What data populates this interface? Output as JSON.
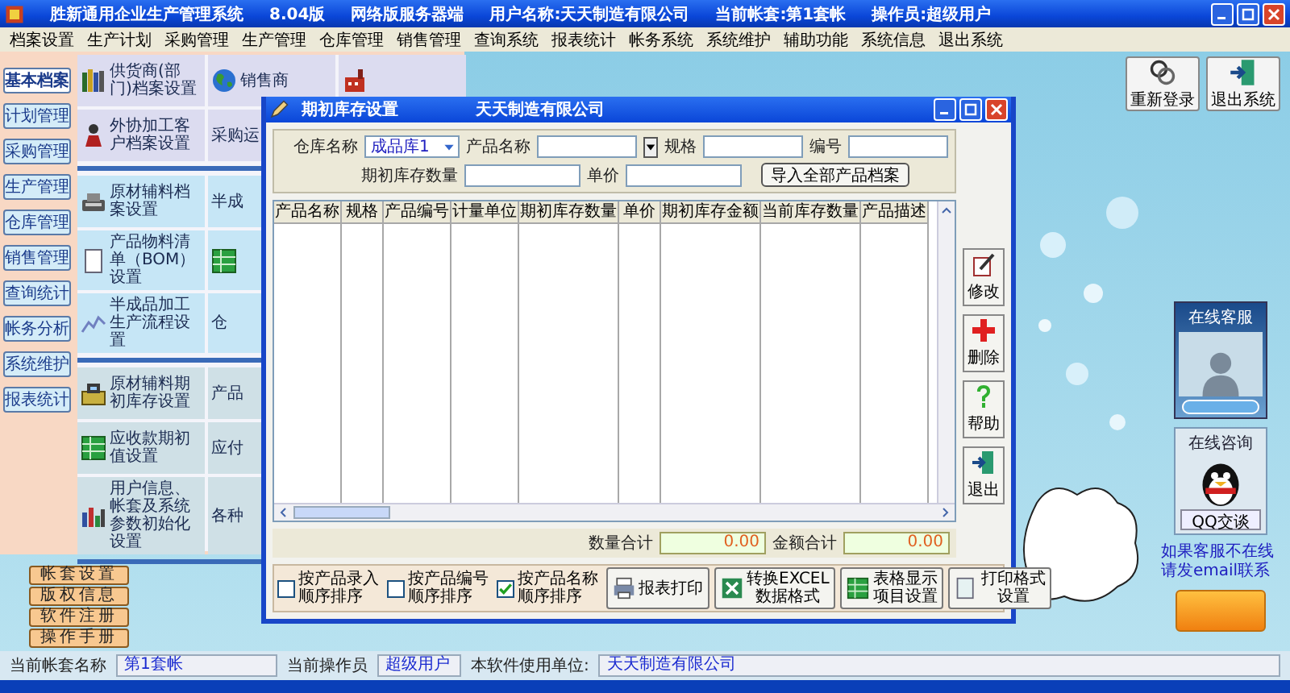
{
  "window": {
    "title": "胜新通用企业生产管理系统",
    "version": "8.04版",
    "edition": "网络版服务器端",
    "user_name": "用户名称:天天制造有限公司",
    "account_set": "当前帐套:第1套帐",
    "operator": "操作员:超级用户"
  },
  "menu": [
    "档案设置",
    "生产计划",
    "采购管理",
    "生产管理",
    "仓库管理",
    "销售管理",
    "查询系统",
    "报表统计",
    "帐务系统",
    "系统维护",
    "辅助功能",
    "系统信息",
    "退出系统"
  ],
  "side_tabs": [
    {
      "label": "基本档案",
      "selected": true
    },
    {
      "label": "计划管理",
      "selected": false
    },
    {
      "label": "采购管理",
      "selected": false
    },
    {
      "label": "生产管理",
      "selected": false
    },
    {
      "label": "仓库管理",
      "selected": false
    },
    {
      "label": "销售管理",
      "selected": false
    },
    {
      "label": "查询统计",
      "selected": false
    },
    {
      "label": "帐务分析",
      "selected": false
    },
    {
      "label": "系统维护",
      "selected": false
    },
    {
      "label": "报表统计",
      "selected": false
    }
  ],
  "tile_groups": [
    {
      "rows": [
        [
          {
            "label": "供货商(部门)档案设置"
          },
          {
            "label": "销售商"
          }
        ],
        [
          {
            "label": "外协加工客户档案设置"
          },
          {
            "label": "采购运"
          }
        ]
      ]
    },
    {
      "rows": [
        [
          {
            "label": "原材辅料档案设置"
          },
          {
            "label": "半成"
          }
        ],
        [
          {
            "label": "产品物料清单（BOM）设置"
          },
          {}
        ],
        [
          {
            "label": "半成品加工生产流程设置"
          },
          {
            "label": "仓"
          }
        ]
      ]
    },
    {
      "rows": [
        [
          {
            "label": "原材辅料期初库存设置"
          },
          {
            "label": "产品"
          }
        ],
        [
          {
            "label": "应收款期初值设置"
          },
          {
            "label": "应付"
          }
        ],
        [
          {
            "label": "用户信息、帐套及系统参数初始化设置"
          },
          {
            "label": "各种"
          }
        ]
      ]
    }
  ],
  "shortcut_buttons": [
    "帐套设置",
    "版权信息",
    "软件注册",
    "操作手册"
  ],
  "top_buttons": [
    "重新登录",
    "退出系统"
  ],
  "support": {
    "service_title": "在线客服",
    "consult_title": "在线咨询",
    "qq_button": "QQ交谈",
    "email_note": "如果客服不在线请发email联系"
  },
  "status_bar": [
    {
      "label": "当前帐套名称",
      "value": "第1套帐"
    },
    {
      "label": "当前操作员",
      "value": "超级用户"
    },
    {
      "label": "本软件使用单位:",
      "value": "天天制造有限公司"
    }
  ],
  "dialog": {
    "title": "期初库存设置",
    "company": "天天制造有限公司",
    "form": {
      "warehouse_label": "仓库名称",
      "warehouse_value": "成品库1",
      "product_label": "产品名称",
      "spec_label": "规格",
      "code_label": "编号",
      "qty_label": "期初库存数量",
      "price_label": "单价",
      "import_button": "导入全部产品档案"
    },
    "columns": [
      "产品名称",
      "规格",
      "产品编号",
      "计量单位",
      "期初库存数量",
      "单价",
      "期初库存金额",
      "当前库存数量",
      "产品描述"
    ],
    "side_buttons": [
      "修改",
      "删除",
      "帮助",
      "退出"
    ],
    "totals": [
      {
        "label": "数量合计",
        "value": "0.00"
      },
      {
        "label": "金额合计",
        "value": "0.00"
      }
    ],
    "sort_options": [
      {
        "label": "按产品录入顺序排序",
        "checked": false
      },
      {
        "label": "按产品编号顺序排序",
        "checked": false
      },
      {
        "label": "按产品名称顺序排序",
        "checked": true
      }
    ],
    "actions": [
      {
        "lines": [
          "报表打印"
        ]
      },
      {
        "lines": [
          "转换EXCEL",
          "数据格式"
        ]
      },
      {
        "lines": [
          "表格显示",
          "项目设置"
        ]
      },
      {
        "lines": [
          "打印格式",
          "设置"
        ]
      }
    ]
  }
}
